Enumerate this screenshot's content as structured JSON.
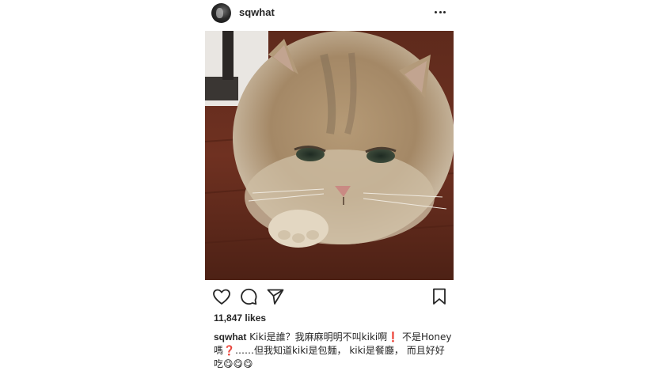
{
  "post": {
    "username": "sqwhat",
    "likes": "11,847 likes",
    "caption": {
      "username": "sqwhat",
      "text": "Kiki是誰？我麻麻明明不叫kiki啊❗ 不是Honey嗎❓……但我知道kiki是包麵， kiki是餐廳， 而且好好吃😋😋😋"
    }
  },
  "icons": {
    "avatar": "profile-avatar",
    "more": "more-options-icon",
    "like": "heart-icon",
    "comment": "comment-bubble-icon",
    "share": "paper-plane-icon",
    "save": "bookmark-icon"
  },
  "colors": {
    "text": "#262626",
    "background": "#ffffff"
  }
}
